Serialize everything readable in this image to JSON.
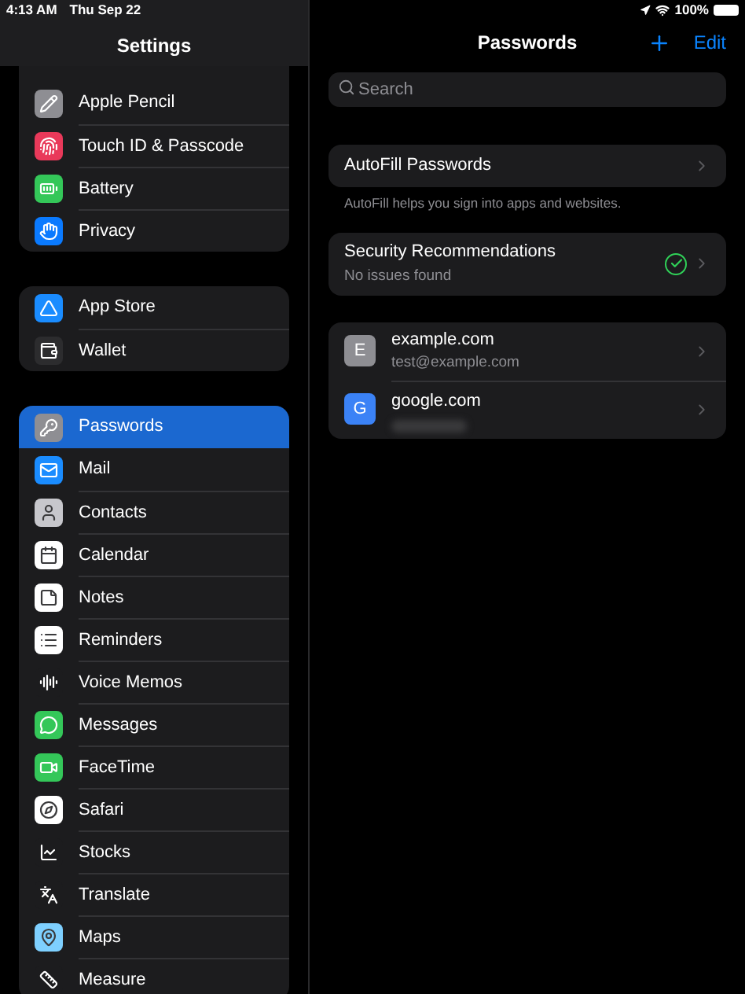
{
  "status_bar": {
    "time": "4:13 AM",
    "date": "Thu Sep 22",
    "battery_text": "100%"
  },
  "sidebar": {
    "title": "Settings",
    "groups": [
      {
        "items": [
          {
            "label": "Apple Pencil",
            "kind": "pencil",
            "color": "#8e8e93",
            "selected": false
          },
          {
            "label": "Touch ID & Passcode",
            "kind": "fingerprint",
            "color": "#e9395a",
            "selected": false
          },
          {
            "label": "Battery",
            "kind": "battery",
            "color": "#34c759",
            "selected": false
          },
          {
            "label": "Privacy",
            "kind": "hand",
            "color": "#0a7aff",
            "selected": false
          }
        ]
      },
      {
        "items": [
          {
            "label": "App Store",
            "kind": "store",
            "color": "#1a8cff",
            "selected": false
          },
          {
            "label": "Wallet",
            "kind": "wallet",
            "color": "#2c2c2e",
            "selected": false
          }
        ]
      },
      {
        "items": [
          {
            "label": "Passwords",
            "kind": "key",
            "color": "#8e8e93",
            "selected": true
          },
          {
            "label": "Mail",
            "kind": "mail",
            "color": "#1a8cff",
            "selected": false
          },
          {
            "label": "Contacts",
            "kind": "contacts",
            "color": "#c7c7cc",
            "selected": false
          },
          {
            "label": "Calendar",
            "kind": "calendar",
            "color": "#ffffff",
            "selected": false
          },
          {
            "label": "Notes",
            "kind": "notes",
            "color": "#ffffff",
            "selected": false
          },
          {
            "label": "Reminders",
            "kind": "reminders",
            "color": "#ffffff",
            "selected": false
          },
          {
            "label": "Voice Memos",
            "kind": "voice",
            "color": "#1c1c1e",
            "selected": false
          },
          {
            "label": "Messages",
            "kind": "messages",
            "color": "#34c759",
            "selected": false
          },
          {
            "label": "FaceTime",
            "kind": "facetime",
            "color": "#34c759",
            "selected": false
          },
          {
            "label": "Safari",
            "kind": "safari",
            "color": "#ffffff",
            "selected": false
          },
          {
            "label": "Stocks",
            "kind": "stocks",
            "color": "#1c1c1e",
            "selected": false
          },
          {
            "label": "Translate",
            "kind": "translate",
            "color": "#1c1c1e",
            "selected": false
          },
          {
            "label": "Maps",
            "kind": "maps",
            "color": "#7ed0ff",
            "selected": false
          },
          {
            "label": "Measure",
            "kind": "measure",
            "color": "#1c1c1e",
            "selected": false
          }
        ]
      }
    ]
  },
  "detail": {
    "title": "Passwords",
    "edit": "Edit",
    "search": {
      "placeholder": "Search"
    },
    "autofill": {
      "label": "AutoFill Passwords",
      "footer": "AutoFill helps you sign into apps and websites."
    },
    "security": {
      "title": "Security Recommendations",
      "subtitle": "No issues found"
    },
    "accounts": [
      {
        "letter": "E",
        "site": "example.com",
        "user": "test@example.com",
        "color": "#8e8e93",
        "redacted": false
      },
      {
        "letter": "G",
        "site": "google.com",
        "color": "#3b82f6",
        "redacted": true
      }
    ]
  }
}
